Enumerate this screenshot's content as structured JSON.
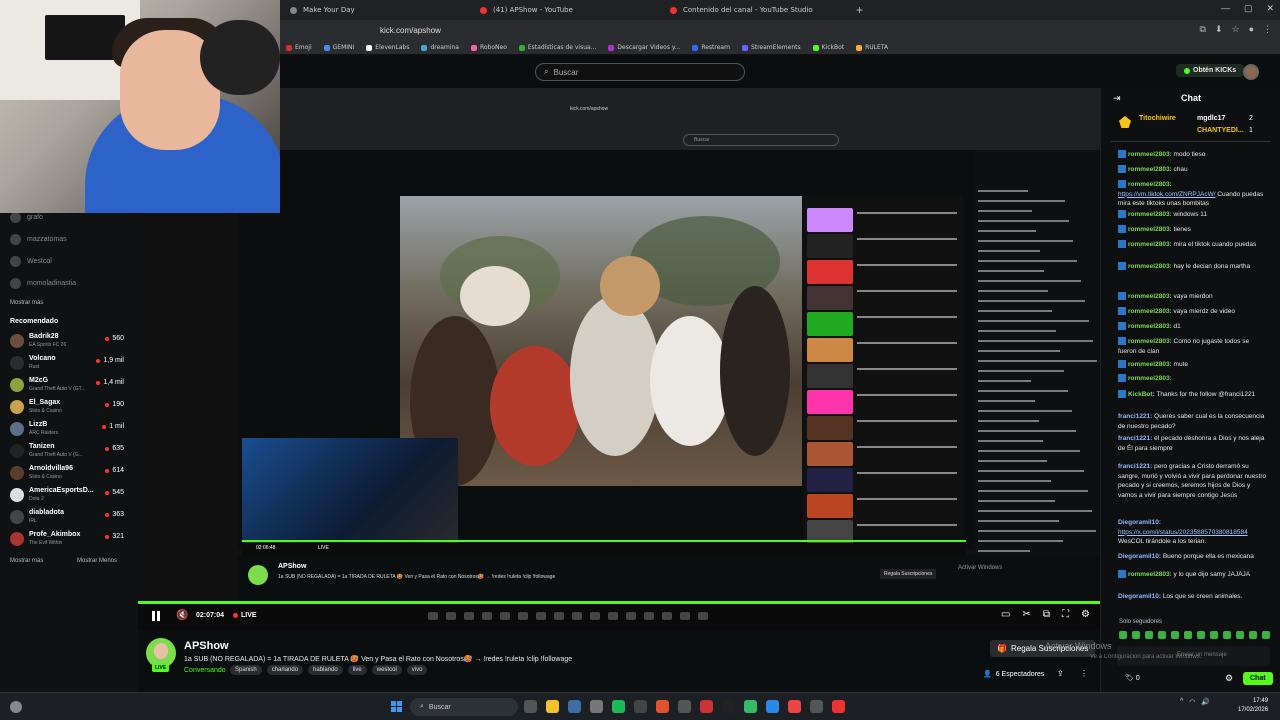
{
  "browser": {
    "tabs": [
      {
        "label": "Make Your Day"
      },
      {
        "label": "(41) APShow - YouTube"
      },
      {
        "label": "Contenido del canal - YouTube Studio"
      }
    ],
    "url": "kick.com/apshow",
    "bookmarks": [
      "Emoji",
      "GEMINI",
      "ElevenLabs",
      "dreamina",
      "RoboNeo",
      "Estadísticas de visua...",
      "Descargar Videos y...",
      "Restream",
      "StreamElements",
      "KickBot",
      "RULETA"
    ]
  },
  "header": {
    "search_placeholder": "Buscar",
    "kicks_button": "Obtén KICKs"
  },
  "sidebar": {
    "followed": [
      {
        "name": "grafo"
      },
      {
        "name": "mazzatomas"
      },
      {
        "name": "Westcol"
      },
      {
        "name": "momoladinastia"
      }
    ],
    "show_more": "Mostrar más",
    "recommended_title": "Recomendado",
    "recommended": [
      {
        "name": "Badrik28",
        "category": "EA Sports FC 26",
        "viewers": "560",
        "color": "#6b4f3a"
      },
      {
        "name": "Volcano",
        "category": "Rust",
        "viewers": "1,9 mil",
        "color": "#2c2c2c"
      },
      {
        "name": "M2cG",
        "category": "Grand Theft Auto V (GT...",
        "viewers": "1,4 mil",
        "color": "#8fa03a"
      },
      {
        "name": "El_Sagax",
        "category": "Slots & Casino",
        "viewers": "190",
        "color": "#c9a24c"
      },
      {
        "name": "LizzB",
        "category": "ARC Raiders",
        "viewers": "1 mil",
        "color": "#5b6f8a"
      },
      {
        "name": "Tanizen",
        "category": "Grand Theft Auto V (G...",
        "viewers": "635",
        "color": "#222"
      },
      {
        "name": "Arnoldvilla96",
        "category": "Slots & Casino",
        "viewers": "614",
        "color": "#5a3d2b"
      },
      {
        "name": "AmericaEsportsD...",
        "category": "Dota 2",
        "viewers": "545",
        "color": "#ddd"
      },
      {
        "name": "diabladota",
        "category": "IRL",
        "viewers": "363",
        "color": "#444"
      },
      {
        "name": "Profe_Akimbox",
        "category": "The Evil Within",
        "viewers": "321",
        "color": "#a33"
      }
    ],
    "show_more_2": "Mostrar más",
    "show_less": "Mostrar Menos"
  },
  "nested": {
    "url": "kick.com/apshow",
    "search": "Buscar",
    "time": "02:06:48",
    "live": "LIVE",
    "streamer": "APShow",
    "title": "1a SUB (NO REGALADA) = 1a TIRADA DE RULETA 🥵 Ven y Pasa el Rato con Nosotros🥵 → !redes !ruleta !clip !followage",
    "subs": "Regala Suscripciones",
    "watermark": "Activar Windows"
  },
  "player": {
    "time": "02:07:04",
    "live": "LIVE"
  },
  "stream": {
    "name": "APShow",
    "live_badge": "LIVE",
    "title": "1a SUB (NO REGALADA) = 1a TIRADA DE RULETA 🥵 Ven y Pasa el Rato con Nosotros🥵 → !redes !ruleta !clip !followage",
    "category": "Conversando",
    "tags": [
      "Spanish",
      "charlando",
      "hablando",
      "live",
      "westcol",
      "vivo"
    ],
    "subs_button": "Regala Suscripciones",
    "viewers": "6 Espectadores"
  },
  "chat": {
    "title": "Chat",
    "pinned": {
      "user1": "Titochiwire",
      "user2": "mgdlc17",
      "user3": "CHANTYEDI...",
      "n1": "2",
      "n2": "1"
    },
    "messages": [
      {
        "user": "rommeel2803:",
        "text": "modo tieso"
      },
      {
        "user": "rommeel2803:",
        "text": "chau"
      },
      {
        "user": "rommeel2803:",
        "link": "https://vm.tiktok.com/ZNRPJAcW/",
        "text": " Cuando puedas mira este tiktoks unas bombitas"
      },
      {
        "user": "rommeel2803:",
        "text": "windows 11"
      },
      {
        "user": "rommeel2803:",
        "text": "tienes"
      },
      {
        "user": "rommeel2803:",
        "text": "mira el tiktok cuando puedas"
      },
      {
        "user": "rommeel2803:",
        "text": "hay le decian dona martha"
      },
      {
        "user": "rommeel2803:",
        "text": "vaya mierdon"
      },
      {
        "user": "rommeel2803:",
        "text": "vaya mierdz de video"
      },
      {
        "user": "rommeel2803:",
        "text": "d1"
      },
      {
        "user": "rommeel2803:",
        "text": "Como no jugaste todos se fueron de clan"
      },
      {
        "user": "rommeel2803:",
        "text": "mute"
      },
      {
        "user": "rommeel2803:",
        "text": ""
      },
      {
        "user": "KickBot:",
        "text": "Thanks for the follow @franci1221"
      },
      {
        "user": "franci1221:",
        "text": "Queres saber cual es la consecuencia de nuestro pecado?"
      },
      {
        "user": "franci1221:",
        "text": "el pecado deshonra a Dios y nos aleja de Él para siempre"
      },
      {
        "user": "franci1221:",
        "text": "pero gracias a Cristo derramó su sangre, murió y volvió a vivir para perdonar nuestro pecado y si creemos, seremos hijos de Dios y vamos a vivir para siempre contigo Jesús"
      },
      {
        "user": "Diegoramil10:",
        "link": "https://x.com/i/status/2023588570380818584",
        "text": " WesCOL tirándole a los terian."
      },
      {
        "user": "Diegoramil10:",
        "text": "Bueno porque ella es mexicana"
      },
      {
        "user": "rommeel2803:",
        "text": "y lo que dijo samy JAJAJA"
      },
      {
        "user": "Diegoramil10:",
        "text": "Los que se creen animales."
      }
    ],
    "followers_only": "Solo seguidores",
    "input_placeholder": "Enviar un mensaje",
    "kicks": "0",
    "chat_button": "Chat"
  },
  "watermark": {
    "line1": "Activar Windows",
    "line2": "Ve a Configuración para activar Windows."
  },
  "taskbar": {
    "search": "Buscar",
    "time": "17:49",
    "date": "17/02/2026"
  }
}
